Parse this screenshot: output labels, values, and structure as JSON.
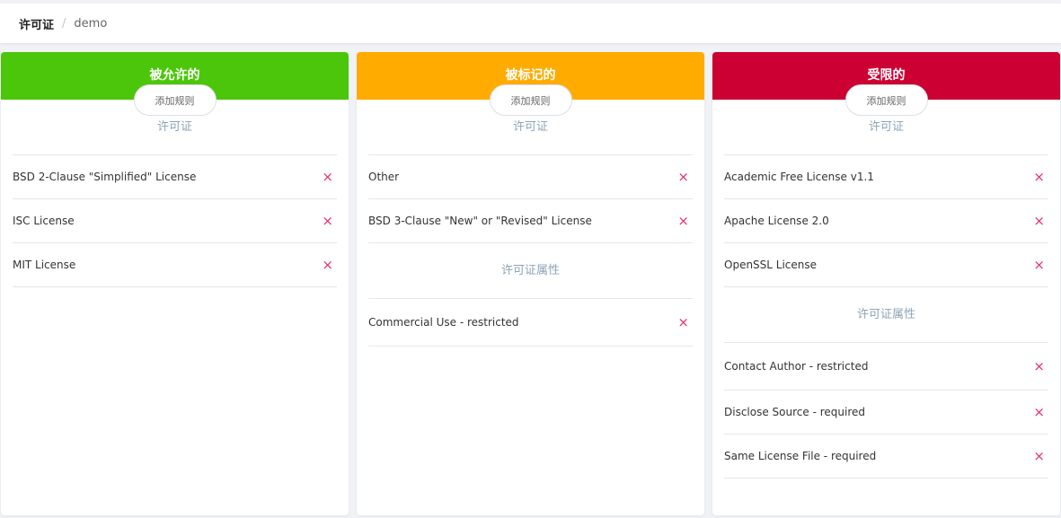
{
  "breadcrumb": {
    "root": "许可证",
    "separator": "/",
    "leaf": "demo"
  },
  "colors": {
    "allowed": "#4cc60a",
    "flagged": "#ffab00",
    "restricted": "#cc0033",
    "delete": "#e5306a"
  },
  "panels": [
    {
      "title": "被允许的",
      "add_label": "添加规则",
      "license_title": "许可证",
      "licenses": [
        "BSD 2-Clause \"Simplified\" License",
        "ISC License",
        "MIT License"
      ],
      "attr_title": "",
      "attributes": []
    },
    {
      "title": "被标记的",
      "add_label": "添加规则",
      "license_title": "许可证",
      "licenses": [
        "Other",
        "BSD 3-Clause \"New\" or \"Revised\" License"
      ],
      "attr_title": "许可证属性",
      "attributes": [
        "Commercial Use - restricted"
      ]
    },
    {
      "title": "受限的",
      "add_label": "添加规则",
      "license_title": "许可证",
      "licenses": [
        "Academic Free License v1.1",
        "Apache License 2.0",
        "OpenSSL License"
      ],
      "attr_title": "许可证属性",
      "attributes": [
        "Contact Author - restricted",
        "Disclose Source - required",
        "Same License File - required"
      ]
    }
  ],
  "delete_glyph": "×"
}
